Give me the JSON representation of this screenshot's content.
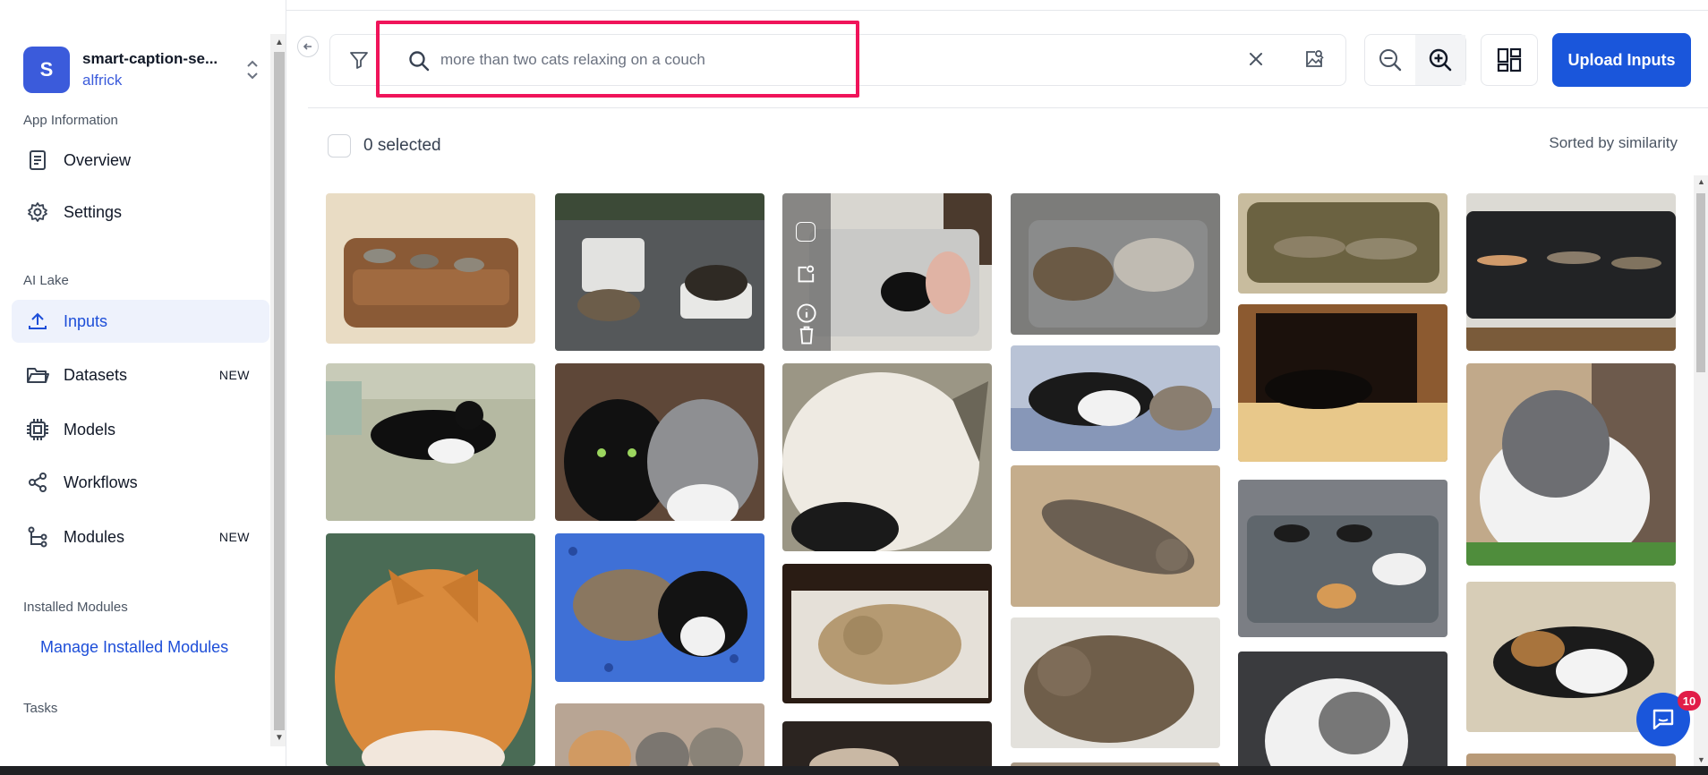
{
  "app": {
    "avatar_letter": "S",
    "name": "smart-caption-se...",
    "user": "alfrick"
  },
  "sidebar": {
    "sections": {
      "app_info": "App Information",
      "ai_lake": "AI Lake",
      "installed": "Installed Modules",
      "tasks": "Tasks"
    },
    "items": [
      {
        "label": "Overview",
        "icon": "document-icon"
      },
      {
        "label": "Settings",
        "icon": "gear-icon"
      },
      {
        "label": "Inputs",
        "icon": "upload-icon",
        "active": true
      },
      {
        "label": "Datasets",
        "icon": "folder-icon",
        "badge": "NEW"
      },
      {
        "label": "Models",
        "icon": "chip-icon"
      },
      {
        "label": "Workflows",
        "icon": "share-icon"
      },
      {
        "label": "Modules",
        "icon": "modules-icon",
        "badge": "NEW"
      }
    ],
    "manage_modules": "Manage Installed Modules"
  },
  "search": {
    "placeholder": "more than two cats relaxing on a couch",
    "value": ""
  },
  "toolbar": {
    "upload_label": "Upload Inputs"
  },
  "selection": {
    "label": "0 selected"
  },
  "sort": {
    "label": "Sorted by similarity"
  },
  "chat": {
    "badge": "10"
  },
  "colors": {
    "accent": "#1a56db",
    "highlight": "#f0145a",
    "badge": "#e11d48"
  }
}
